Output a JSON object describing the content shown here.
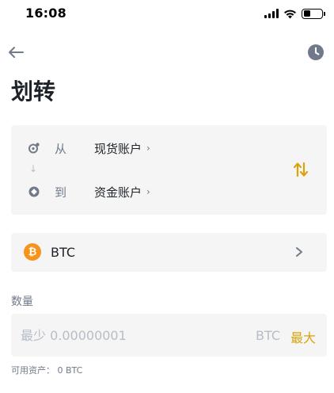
{
  "status_bar": {
    "time": "16:08"
  },
  "header": {
    "back_icon": "arrow-left-icon",
    "history_icon": "clock-icon",
    "title": "划转"
  },
  "transfer": {
    "from": {
      "label": "从",
      "account": "现货账户",
      "icon": "spot-wallet-icon"
    },
    "to": {
      "label": "到",
      "account": "资金账户",
      "icon": "funding-wallet-icon"
    },
    "swap_icon": "swap-arrows-icon"
  },
  "coin": {
    "name": "BTC",
    "logo_glyph": "₿",
    "logo_color": "#f7931a"
  },
  "amount": {
    "label": "数量",
    "placeholder": "最少 0.00000001",
    "unit": "BTC",
    "max_label": "最大",
    "available_text": "可用资产：  0 BTC"
  },
  "colors": {
    "accent": "#d9a40a",
    "card_bg": "#f5f5f5",
    "text_primary": "#1e2329",
    "text_secondary": "#707a8a",
    "text_placeholder": "#b7bdc6"
  }
}
